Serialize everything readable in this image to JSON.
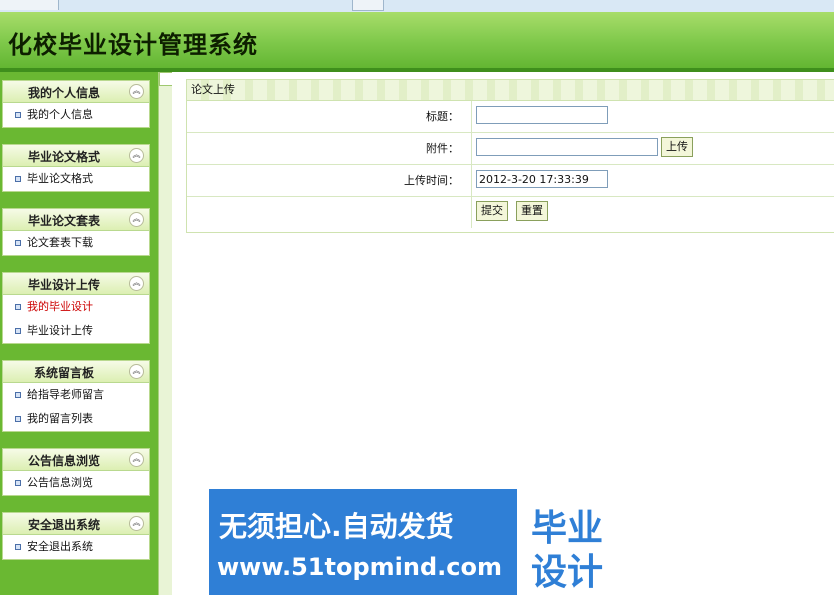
{
  "app": {
    "title": "化校毕业设计管理系统"
  },
  "sidebar": {
    "groups": [
      {
        "title": "我的个人信息",
        "items": [
          "我的个人信息"
        ]
      },
      {
        "title": "毕业论文格式",
        "items": [
          "毕业论文格式"
        ]
      },
      {
        "title": "毕业论文套表",
        "items": [
          "论文套表下载"
        ]
      },
      {
        "title": "毕业设计上传",
        "items": [
          "我的毕业设计",
          "毕业设计上传"
        ]
      },
      {
        "title": "系统留言板",
        "items": [
          "给指导老师留言",
          "我的留言列表"
        ]
      },
      {
        "title": "公告信息浏览",
        "items": [
          "公告信息浏览"
        ]
      },
      {
        "title": "安全退出系统",
        "items": [
          "安全退出系统"
        ]
      }
    ],
    "active_item": "我的毕业设计",
    "collapse_icon": "double-chevron-up-icon"
  },
  "form": {
    "panel_title": "论文上传",
    "title_label": "标题：",
    "title_value": "",
    "attachment_label": "附件：",
    "attachment_value": "",
    "upload_button": "上传",
    "time_label": "上传时间：",
    "time_value": "2012-3-20 17:33:39",
    "submit_button": "提交",
    "reset_button": "重置"
  },
  "banner": {
    "line1": "无须担心.自动发货",
    "line2": "www.51topmind.com",
    "box_line1": "毕业",
    "box_line2": "设计"
  },
  "colors": {
    "header": "#7ec84a",
    "sidebar": "#6ab832",
    "active_link": "#cc0000",
    "banner": "#2f7fd6"
  }
}
